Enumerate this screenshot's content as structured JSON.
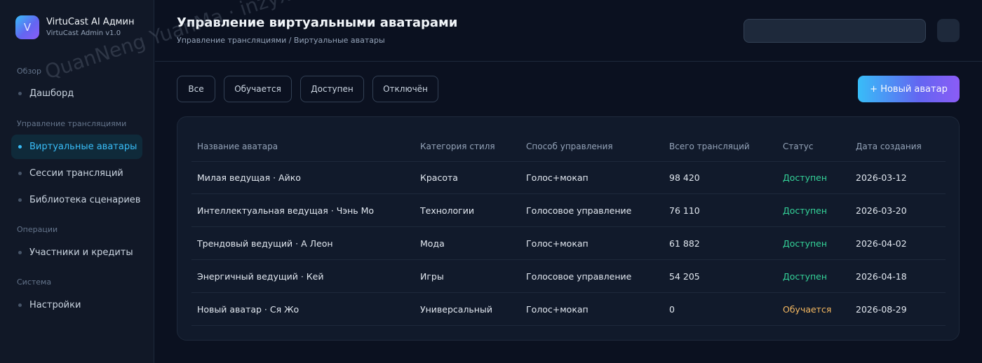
{
  "brand": {
    "logo_letter": "V",
    "title": "VirtuCast AI Админ",
    "subtitle": "VirtuCast Admin v1.0"
  },
  "sidebar": {
    "sections": [
      {
        "label": "Обзор",
        "items": [
          {
            "label": "Дашборд",
            "active": false
          }
        ]
      },
      {
        "label": "Управление трансляциями",
        "items": [
          {
            "label": "Виртуальные аватары",
            "active": true
          },
          {
            "label": "Сессии трансляций",
            "active": false
          },
          {
            "label": "Библиотека сценариев",
            "active": false
          }
        ]
      },
      {
        "label": "Операции",
        "items": [
          {
            "label": "Участники и кредиты",
            "active": false
          }
        ]
      },
      {
        "label": "Система",
        "items": [
          {
            "label": "Настройки",
            "active": false
          }
        ]
      }
    ]
  },
  "header": {
    "title": "Управление виртуальными аватарами",
    "breadcrumb": "Управление трансляциями / Виртуальные аватары",
    "search_value": ""
  },
  "filters": [
    "Все",
    "Обучается",
    "Доступен",
    "Отключён"
  ],
  "new_button": "+ Новый аватар",
  "table": {
    "columns": [
      "Название аватара",
      "Категория стиля",
      "Способ управления",
      "Всего трансляций",
      "Статус",
      "Дата создания"
    ],
    "rows": [
      [
        "Милая ведущая · Айко",
        "Красота",
        "Голос+мокап",
        "98 420",
        "Доступен",
        "2026-03-12"
      ],
      [
        "Интеллектуальная ведущая · Чэнь Мо",
        "Технологии",
        "Голосовое управление",
        "76 110",
        "Доступен",
        "2026-03-20"
      ],
      [
        "Трендовый ведущий · А Леон",
        "Мода",
        "Голос+мокап",
        "61 882",
        "Доступен",
        "2026-04-02"
      ],
      [
        "Энергичный ведущий · Кей",
        "Игры",
        "Голосовое управление",
        "54 205",
        "Доступен",
        "2026-04-18"
      ],
      [
        "Новый аватар · Ся Жо",
        "Универсальный",
        "Голос+мокап",
        "0",
        "Обучается",
        "2026-08-29"
      ]
    ]
  },
  "colors": {
    "accent": "#38bdf8",
    "status_available": "#34d399",
    "status_training": "#f4b860"
  },
  "watermark": "QuanNeng YuanMa · inzyxuashop.com"
}
